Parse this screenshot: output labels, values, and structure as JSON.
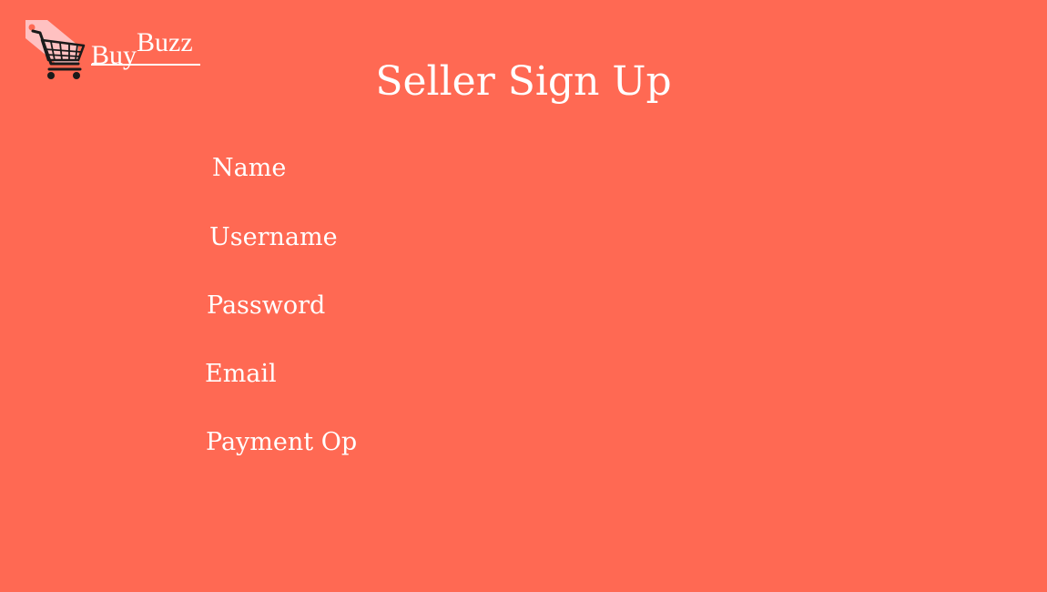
{
  "brand": {
    "name_part1": "Buy",
    "name_part2": "Buzz",
    "logo_icon": "shopping-cart-tag-icon",
    "tag_color": "#FFC1C1",
    "cart_color": "#1A1A1A"
  },
  "colors": {
    "background": "#FF6953",
    "text": "#FFFFFF"
  },
  "page": {
    "title": "Seller Sign Up"
  },
  "form": {
    "fields": [
      {
        "label": "Name"
      },
      {
        "label": "Username"
      },
      {
        "label": "Password"
      },
      {
        "label": "Email"
      },
      {
        "label": "Payment Op"
      }
    ]
  }
}
